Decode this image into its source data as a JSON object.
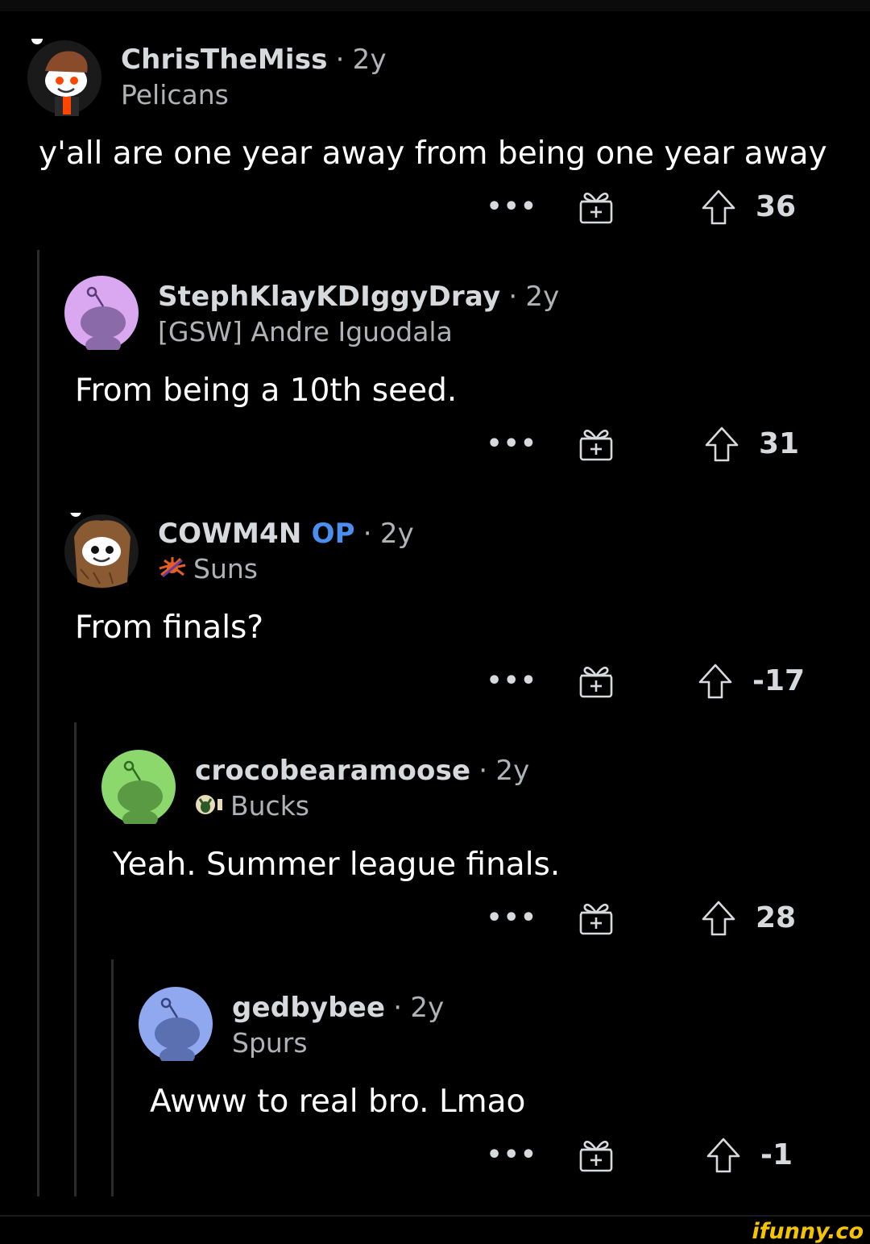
{
  "comments": [
    {
      "username": "ChrisTheMiss",
      "op_label": "",
      "age": "2y",
      "flair": "Pelicans",
      "body": "y'all are one year away from being one year away",
      "score": "36",
      "avatar_color": "#1a1a1a"
    },
    {
      "username": "StephKlayKDIggyDray",
      "op_label": "",
      "age": "2y",
      "flair": "[GSW] Andre Iguodala",
      "body": "From being a 10th seed.",
      "score": "31",
      "avatar_color": "#d9a8f0"
    },
    {
      "username": "COWM4N",
      "op_label": "OP",
      "age": "2y",
      "flair": "Suns",
      "body": "From finals?",
      "score": "-17",
      "avatar_color": "#1a1a1a"
    },
    {
      "username": "crocobearamoose",
      "op_label": "",
      "age": "2y",
      "flair": "Bucks",
      "body": "Yeah. Summer league finals.",
      "score": "28",
      "avatar_color": "#8cd86c"
    },
    {
      "username": "gedbybee",
      "op_label": "",
      "age": "2y",
      "flair": "Spurs",
      "body": "Awww to real bro. Lmao",
      "score": "-1",
      "avatar_color": "#8fa8f0"
    }
  ],
  "separator": "·",
  "more_label": "•••",
  "icons": {
    "more": "more-options-icon",
    "award": "gift-award-icon",
    "upvote": "upvote-arrow-icon",
    "flair_suns": "suns-logo-icon",
    "flair_bucks": "bucks-logo-icon"
  },
  "watermark": "ifunny.co",
  "colors": {
    "background": "#000000",
    "text": "#ffffff",
    "meta": "#b0b3b5",
    "op": "#4a8ff0",
    "thread_line": "#2b2b2b",
    "watermark": "#f5c400"
  }
}
